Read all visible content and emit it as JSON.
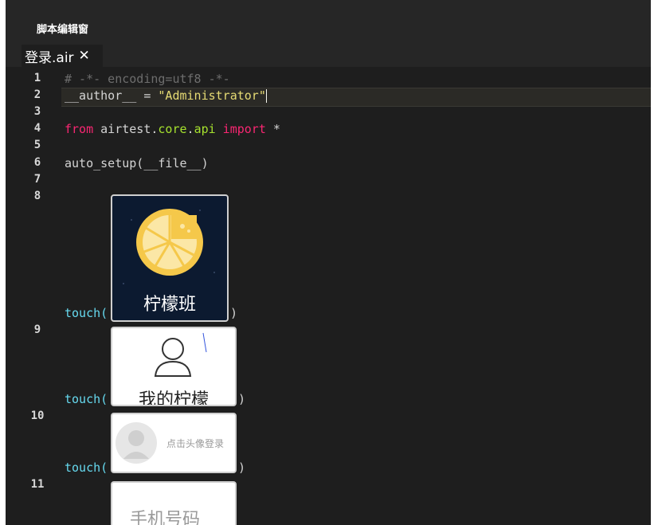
{
  "panel": {
    "title": "脚本编辑窗"
  },
  "tab": {
    "label": "登录.air",
    "close_glyph": "✕"
  },
  "line_numbers": [
    "1",
    "2",
    "3",
    "4",
    "5",
    "6",
    "7",
    "8",
    "9",
    "10",
    "11"
  ],
  "code": {
    "line1": "# -*- encoding=utf8 -*-",
    "line2_name": "__author__",
    "line2_eq": " = ",
    "line2_str": "\"Administrator\"",
    "line4_from": "from",
    "line4_mod1": " airtest",
    "line4_dot1": ".",
    "line4_mod2": "core",
    "line4_dot2": ".",
    "line4_mod3": "api",
    "line4_import": " import",
    "line4_star": " *",
    "line6": "auto_setup(__file__)",
    "touch": "touch(",
    "close_paren": ")"
  },
  "images": {
    "img1_label": "柠檬班",
    "img2_label": "我的柠檬",
    "img3_label": "点击头像登录",
    "img4_label": "手机号码"
  },
  "colors": {
    "background": "#1e1e1e",
    "keyword": "#f92672",
    "string": "#e6db74",
    "function": "#66d9ef",
    "module": "#a6e22e",
    "comment": "#6d6d6d"
  }
}
